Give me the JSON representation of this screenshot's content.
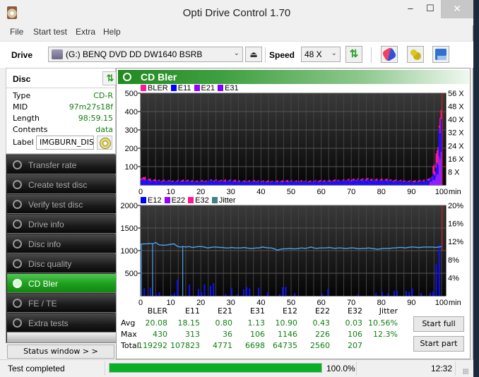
{
  "window": {
    "title": "Opti Drive Control 1.70",
    "minimize": "‒",
    "maximize": "☐",
    "close": "✕"
  },
  "menu": [
    "File",
    "Start test",
    "Extra",
    "Help"
  ],
  "toolbar": {
    "drive_label": "Drive",
    "drive_value": "(G:)   BENQ DVD DD DW1640 BSRB",
    "speed_label": "Speed",
    "speed_value": "48 X",
    "icons": [
      "eject-icon",
      "refresh-icon",
      "erase-icon",
      "settings-icon",
      "save-icon"
    ]
  },
  "disc": {
    "title": "Disc",
    "fields": [
      {
        "key": "Type",
        "value": "CD-R"
      },
      {
        "key": "MID",
        "value": "97m27s18f"
      },
      {
        "key": "Length",
        "value": "98:59.15"
      },
      {
        "key": "Contents",
        "value": "data"
      }
    ],
    "label_key": "Label",
    "label_value": "IMGBURN_DIS"
  },
  "nav": {
    "items": [
      {
        "label": "Transfer rate",
        "active": false
      },
      {
        "label": "Create test disc",
        "active": false
      },
      {
        "label": "Verify test disc",
        "active": false
      },
      {
        "label": "Drive info",
        "active": false
      },
      {
        "label": "Disc info",
        "active": false
      },
      {
        "label": "Disc quality",
        "active": false
      },
      {
        "label": "CD Bler",
        "active": true
      },
      {
        "label": "FE / TE",
        "active": false
      },
      {
        "label": "Extra tests",
        "active": false
      }
    ],
    "status_window": "Status window > >"
  },
  "main": {
    "title": "CD Bler",
    "start_full": "Start full",
    "start_part": "Start part"
  },
  "chart_data": [
    {
      "type": "bar",
      "title": "CD Bler - upper",
      "legend": [
        {
          "name": "BLER",
          "color": "#ff1493"
        },
        {
          "name": "E11",
          "color": "#0000ff"
        },
        {
          "name": "E21",
          "color": "#9400ff"
        },
        {
          "name": "E31",
          "color": "#8000ff"
        }
      ],
      "xlabel": "min",
      "xlim": [
        0,
        100
      ],
      "xticks": [
        0,
        10,
        20,
        30,
        40,
        50,
        60,
        70,
        80,
        90,
        100
      ],
      "ylim": [
        0,
        500
      ],
      "yticks": [
        100,
        200,
        300,
        400,
        500
      ],
      "y2ticks": [
        "8 X",
        "16 X",
        "24 X",
        "32 X",
        "40 X",
        "48 X",
        "56 X"
      ],
      "y2lim": [
        0,
        56
      ],
      "grid": true,
      "series_summary": {
        "BLER_typical": 20,
        "E11_typical": 18,
        "end_spike_minute": 99,
        "BLER_end_max": 430
      },
      "profile_bler": [
        45,
        38,
        30,
        28,
        26,
        25,
        24,
        24,
        23,
        22,
        22,
        22,
        23,
        24,
        24,
        23,
        22,
        22,
        21,
        21,
        22,
        22,
        24,
        26,
        25,
        24,
        23,
        24,
        26,
        25,
        24,
        23,
        22,
        22,
        21,
        21,
        21,
        21,
        21,
        21,
        21,
        20,
        20,
        20,
        21,
        21,
        21,
        21,
        22,
        22,
        21,
        21,
        21,
        21,
        21,
        21,
        21,
        21,
        22,
        22,
        22,
        23,
        23,
        24,
        24,
        25,
        25,
        26,
        27,
        28,
        28,
        29,
        30,
        30,
        31,
        31,
        30,
        30,
        29,
        29,
        28,
        28,
        27,
        26,
        25,
        24,
        23,
        22,
        22,
        21,
        21,
        21,
        22,
        23,
        25,
        30,
        45,
        90,
        180,
        430
      ],
      "profile_e11": [
        30,
        28,
        25,
        22,
        22,
        21,
        21,
        20,
        20,
        19,
        19,
        19,
        20,
        21,
        21,
        20,
        19,
        19,
        18,
        18,
        19,
        19,
        21,
        22,
        22,
        21,
        20,
        21,
        22,
        22,
        21,
        20,
        19,
        19,
        18,
        18,
        18,
        18,
        18,
        18,
        18,
        17,
        17,
        17,
        18,
        18,
        18,
        18,
        19,
        19,
        18,
        18,
        18,
        18,
        18,
        18,
        18,
        18,
        19,
        19,
        19,
        20,
        20,
        21,
        21,
        22,
        22,
        23,
        23,
        24,
        24,
        25,
        26,
        26,
        27,
        27,
        26,
        26,
        25,
        25,
        24,
        24,
        23,
        22,
        21,
        20,
        20,
        19,
        19,
        18,
        18,
        18,
        19,
        20,
        21,
        25,
        35,
        60,
        110,
        313
      ]
    },
    {
      "type": "bar",
      "title": "CD Bler - lower",
      "legend": [
        {
          "name": "E12",
          "color": "#0000ff"
        },
        {
          "name": "E22",
          "color": "#9400ff"
        },
        {
          "name": "E32",
          "color": "#ff1493"
        },
        {
          "name": "Jitter",
          "color": "#408080"
        }
      ],
      "xlabel": "min",
      "xlim": [
        0,
        100
      ],
      "xticks": [
        0,
        10,
        20,
        30,
        40,
        50,
        60,
        70,
        80,
        90,
        100
      ],
      "ylim": [
        0,
        2000
      ],
      "yticks": [
        500,
        1000,
        1500,
        2000
      ],
      "y2ticks": [
        "4%",
        "8%",
        "12%",
        "16%",
        "20%"
      ],
      "y2lim": [
        0,
        20
      ],
      "grid": true,
      "jitter_line_color": "#4aa3f0",
      "jitter_percent": [
        11.4,
        11.5,
        11.5,
        11.6,
        11.5,
        11.8,
        11.3,
        11.2,
        11.2,
        11.3,
        11.4,
        11.5,
        11.0,
        10.8,
        10.9,
        10.8,
        10.9,
        10.7,
        10.8,
        10.9,
        10.9,
        10.8,
        10.6,
        10.7,
        10.8,
        10.8,
        10.7,
        10.7,
        10.6,
        10.6,
        10.7,
        10.6,
        10.6,
        10.6,
        10.7,
        10.6,
        10.5,
        10.5,
        10.6,
        10.6,
        10.8,
        10.7,
        10.6,
        10.6,
        10.4,
        10.1,
        10.3,
        10.4,
        10.4,
        10.5,
        10.4,
        10.4,
        10.5,
        10.6,
        10.5,
        10.6,
        10.8,
        10.6,
        10.5,
        10.6,
        10.6,
        10.6,
        10.7,
        10.6,
        10.5,
        10.6,
        10.6,
        10.5,
        10.5,
        10.6,
        10.6,
        10.5,
        10.4,
        10.5,
        10.5,
        10.6,
        10.5,
        10.4,
        10.3,
        10.4,
        10.5,
        10.5,
        10.5,
        10.6,
        10.6,
        10.7,
        10.7,
        10.6,
        10.7,
        10.8,
        10.8,
        10.7,
        10.7,
        10.8,
        10.8,
        10.8,
        10.8,
        10.7,
        10.8,
        10.9
      ],
      "e12_spikes": [
        [
          1,
          170
        ],
        [
          3,
          180
        ],
        [
          5,
          30
        ],
        [
          6,
          80
        ],
        [
          10,
          30
        ],
        [
          11,
          60
        ],
        [
          12,
          360
        ],
        [
          16,
          250
        ],
        [
          19,
          150
        ],
        [
          20,
          80
        ],
        [
          21,
          250
        ],
        [
          23,
          220
        ],
        [
          24,
          280
        ],
        [
          28,
          40
        ],
        [
          30,
          180
        ],
        [
          32,
          30
        ],
        [
          34,
          140
        ],
        [
          35,
          200
        ],
        [
          36,
          160
        ],
        [
          39,
          180
        ],
        [
          42,
          80
        ],
        [
          46,
          40
        ],
        [
          47,
          190
        ],
        [
          48,
          200
        ],
        [
          51,
          60
        ],
        [
          60,
          50
        ],
        [
          62,
          150
        ],
        [
          72,
          40
        ],
        [
          78,
          60
        ],
        [
          80,
          90
        ],
        [
          82,
          60
        ],
        [
          84,
          110
        ],
        [
          85,
          110
        ],
        [
          88,
          110
        ],
        [
          89,
          90
        ],
        [
          90,
          160
        ],
        [
          93,
          60
        ],
        [
          96,
          70
        ],
        [
          97,
          100
        ],
        [
          98,
          700
        ],
        [
          99,
          1146
        ]
      ],
      "jitter_drops_at_minutes": [
        0,
        4,
        14
      ]
    }
  ],
  "stats": {
    "columns": [
      "BLER",
      "E11",
      "E21",
      "E31",
      "E12",
      "E22",
      "E32",
      "Jitter"
    ],
    "rows": [
      {
        "label": "Avg",
        "values": [
          "20.08",
          "18.15",
          "0.80",
          "1.13",
          "10.90",
          "0.43",
          "0.03",
          "10.56%"
        ]
      },
      {
        "label": "Max",
        "values": [
          "430",
          "313",
          "36",
          "106",
          "1146",
          "226",
          "106",
          "12.3%"
        ]
      },
      {
        "label": "Total",
        "values": [
          "119292",
          "107823",
          "4771",
          "6698",
          "64735",
          "2560",
          "207",
          ""
        ]
      }
    ]
  },
  "statusbar": {
    "text": "Test completed",
    "progress": 100.0,
    "progress_text": "100.0%",
    "time": "12:32"
  }
}
